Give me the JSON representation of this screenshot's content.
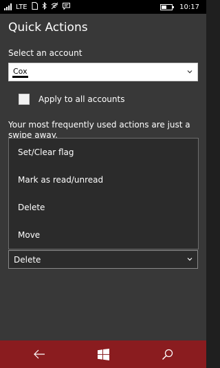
{
  "status_bar": {
    "network": "LTE",
    "time": "10:17",
    "battery_level": 0.5,
    "icons": [
      "signal-icon",
      "sim-icon",
      "bluetooth-icon",
      "wifi-calling-icon",
      "message-icon",
      "battery-icon"
    ]
  },
  "page": {
    "title": "Quick Actions"
  },
  "account": {
    "label": "Select an account",
    "selected": "Cox"
  },
  "apply_all": {
    "label": "Apply to all accounts",
    "checked": false
  },
  "description": "Your most frequently used actions are just a swipe away.",
  "dropdown": {
    "options": [
      "Set/Clear flag",
      "Mark as read/unread",
      "Delete",
      "Move"
    ]
  },
  "action_select": {
    "selected": "Delete"
  },
  "nav": {
    "items": [
      "back-icon",
      "windows-icon",
      "search-icon"
    ]
  },
  "colors": {
    "background": "#383838",
    "nav_bar": "#8a1c1f",
    "status_bar": "#000000"
  }
}
